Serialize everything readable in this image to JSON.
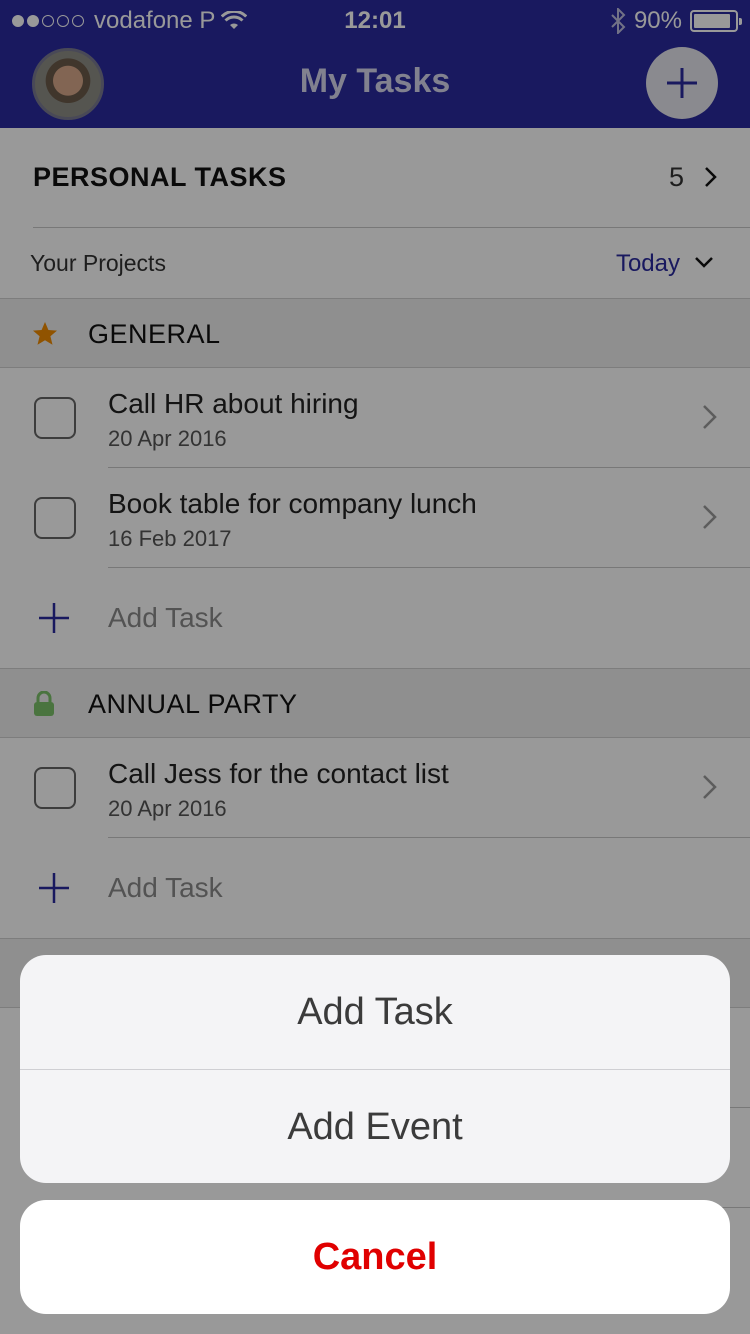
{
  "status_bar": {
    "carrier": "vodafone P",
    "time": "12:01",
    "battery": "90%",
    "signal_dots_full": 2,
    "signal_dots_total": 5
  },
  "header": {
    "title": "My Tasks",
    "avatar_icon": "user-avatar",
    "add_icon": "plus-icon"
  },
  "personal_tasks": {
    "label": "PERSONAL TASKS",
    "count": "5"
  },
  "projects": {
    "label": "Your Projects",
    "filter": "Today"
  },
  "sections": [
    {
      "title": "GENERAL",
      "icon": "star-icon",
      "tasks": [
        {
          "name": "Call HR about hiring",
          "date": "20 Apr 2016"
        },
        {
          "name": "Book table for company lunch",
          "date": "16 Feb 2017"
        }
      ],
      "add_label": "Add Task"
    },
    {
      "title": "ANNUAL PARTY",
      "icon": "lock-icon",
      "tasks": [
        {
          "name": "Call Jess for the contact list",
          "date": "20 Apr 2016"
        }
      ],
      "add_label": "Add Task"
    }
  ],
  "action_sheet": {
    "actions": [
      "Add Task",
      "Add Event"
    ],
    "cancel": "Cancel"
  },
  "colors": {
    "brand": "#2a2a9e",
    "cancel": "#e00000",
    "star": "#f08a00",
    "lock": "#7cc26a"
  }
}
